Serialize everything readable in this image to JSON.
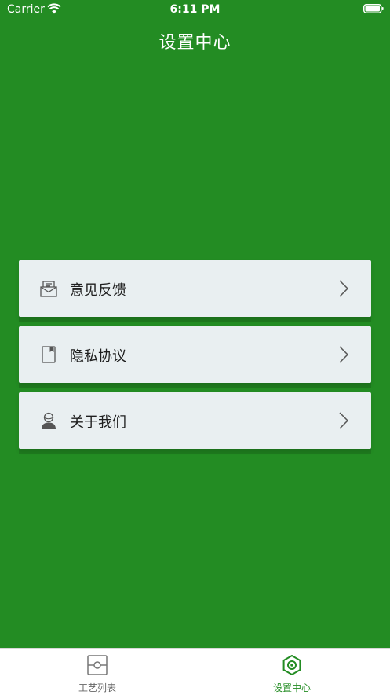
{
  "status_bar": {
    "carrier": "Carrier",
    "time": "6:11 PM"
  },
  "nav": {
    "title": "设置中心"
  },
  "menu": [
    {
      "label": "意见反馈",
      "icon": "feedback-envelope-icon"
    },
    {
      "label": "隐私协议",
      "icon": "document-icon"
    },
    {
      "label": "关于我们",
      "icon": "person-icon"
    }
  ],
  "tab_bar": {
    "tabs": [
      {
        "label": "工艺列表",
        "icon": "process-list-icon",
        "active": false
      },
      {
        "label": "设置中心",
        "icon": "settings-icon",
        "active": true
      }
    ]
  },
  "colors": {
    "background": "#238c23",
    "card": "#e9eff1",
    "active_tab": "#238c23",
    "inactive_tab": "#666666"
  }
}
